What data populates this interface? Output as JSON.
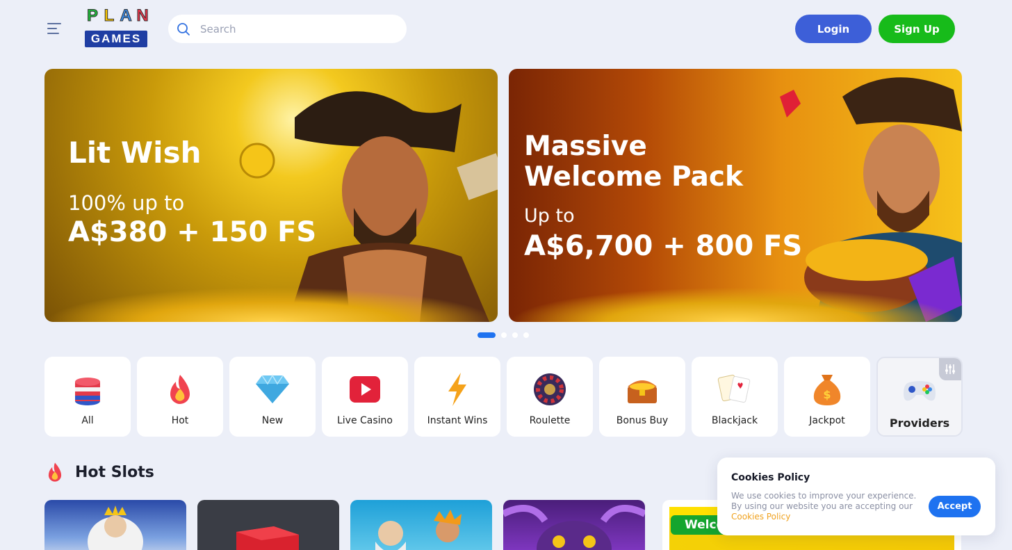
{
  "header": {
    "menu_icon": "menu-icon",
    "logo": {
      "letters": [
        "P",
        "L",
        "A",
        "N"
      ],
      "sub": "GAMES"
    },
    "search": {
      "placeholder": "Search",
      "value": ""
    },
    "login_label": "Login",
    "signup_label": "Sign Up",
    "colors": {
      "login": "#3d5fd8",
      "signup": "#17bb1a"
    }
  },
  "banners": [
    {
      "title": "Lit Wish",
      "subtitle": "100% up to",
      "amount": "A$380 + 150 FS"
    },
    {
      "title": "Massive Welcome Pack",
      "subtitle": "Up to",
      "amount": "A$6,700 + 800 FS"
    }
  ],
  "carousel": {
    "count": 4,
    "active": 0
  },
  "categories": [
    {
      "label": "All",
      "icon": "chips-icon"
    },
    {
      "label": "Hot",
      "icon": "fire-icon"
    },
    {
      "label": "New",
      "icon": "diamond-icon"
    },
    {
      "label": "Live Casino",
      "icon": "play-icon"
    },
    {
      "label": "Instant Wins",
      "icon": "lightning-icon"
    },
    {
      "label": "Roulette",
      "icon": "roulette-icon"
    },
    {
      "label": "Bonus Buy",
      "icon": "treasure-chest-icon"
    },
    {
      "label": "Blackjack",
      "icon": "cards-icon"
    },
    {
      "label": "Jackpot",
      "icon": "money-bag-icon"
    },
    {
      "label": "Providers",
      "icon": "gamepad-icon"
    }
  ],
  "hot_slots": {
    "title": "Hot Slots",
    "icon": "fire-icon"
  },
  "welcome_card": {
    "label": "Welcome Bonus"
  },
  "cookies": {
    "title": "Cookies Policy",
    "text": "We use cookies to improve your experience. By using our website you are accepting our",
    "link": "Cookies Policy",
    "accept": "Accept"
  }
}
